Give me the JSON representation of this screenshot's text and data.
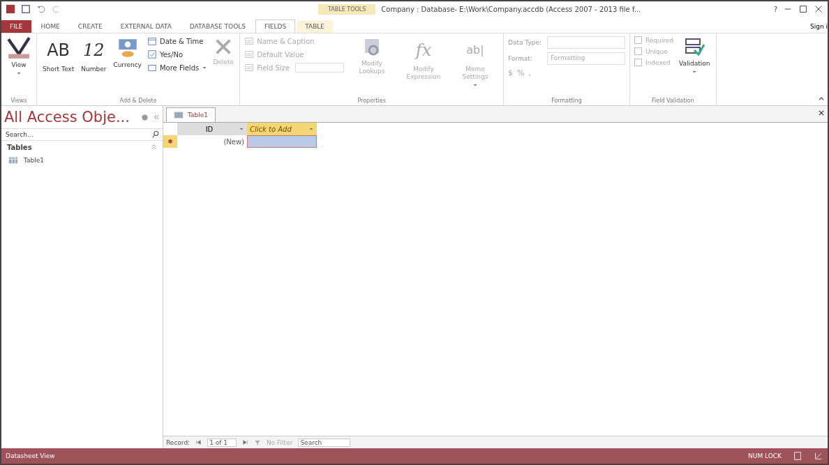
{
  "window": {
    "title": "Company : Database- E:\\Work\\Company.accdb (Access 2007 - 2013 file f...",
    "help": "?",
    "contextual_label": "TABLE TOOLS"
  },
  "tabs": [
    {
      "label": "FILE",
      "kind": "file",
      "selected": false
    },
    {
      "label": "HOME",
      "kind": "normal",
      "selected": false
    },
    {
      "label": "CREATE",
      "kind": "normal",
      "selected": false
    },
    {
      "label": "EXTERNAL DATA",
      "kind": "normal",
      "selected": false
    },
    {
      "label": "DATABASE TOOLS",
      "kind": "normal",
      "selected": false
    },
    {
      "label": "FIELDS",
      "kind": "contextual",
      "selected": true
    },
    {
      "label": "TABLE",
      "kind": "contextual",
      "selected": false
    }
  ],
  "sign_in": "Sign i",
  "ribbon": [
    {
      "label": "Views",
      "items": [
        {
          "kind": "large",
          "label": "View",
          "dropdown": true,
          "disabled": false
        }
      ]
    },
    {
      "label": "Add & Delete",
      "items": [
        {
          "kind": "large",
          "glyph": "AB",
          "label": "Short Text",
          "dropdown": false,
          "disabled": false
        },
        {
          "kind": "large",
          "glyph": "12",
          "label": "Number",
          "dropdown": false,
          "disabled": false
        },
        {
          "kind": "large",
          "label": "Currency",
          "dropdown": false,
          "disabled": false
        },
        {
          "kind": "stack",
          "items": [
            {
              "label": "Date & Time",
              "dropdown": false,
              "disabled": false
            },
            {
              "label": "Yes/No",
              "dropdown": false,
              "disabled": false
            },
            {
              "label": "More Fields",
              "dropdown": true,
              "disabled": false
            }
          ]
        },
        {
          "kind": "large",
          "label": "Delete",
          "dropdown": false,
          "disabled": true
        }
      ]
    },
    {
      "label": "Properties",
      "items": [
        {
          "kind": "stack",
          "items": [
            {
              "label": "Name & Caption",
              "dropdown": false,
              "disabled": true
            },
            {
              "label": "Default Value",
              "dropdown": false,
              "disabled": true
            },
            {
              "label": "Field Size",
              "field": true,
              "dropdown": false,
              "disabled": true
            }
          ]
        },
        {
          "kind": "large",
          "label": "Modify Lookups",
          "dropdown": false,
          "disabled": true
        },
        {
          "kind": "large",
          "glyph": "fx",
          "label": "Modify Expression",
          "dropdown": false,
          "disabled": true
        },
        {
          "kind": "large",
          "glyph": "ab|",
          "label": "Memo Settings",
          "dropdown": true,
          "disabled": true
        }
      ]
    },
    {
      "label": "Formatting",
      "items": [
        {
          "kind": "format",
          "rows": [
            {
              "label": "Data Type:",
              "value": ""
            },
            {
              "label": "Format:",
              "value": "Formatting"
            }
          ],
          "symbols": [
            "$",
            "%",
            ","
          ],
          "disabled": true
        }
      ]
    },
    {
      "label": "Field Validation",
      "items": [
        {
          "kind": "checks",
          "items": [
            {
              "label": "Required",
              "checked": false,
              "disabled": true
            },
            {
              "label": "Unique",
              "checked": false,
              "disabled": true
            },
            {
              "label": "Indexed",
              "checked": false,
              "disabled": true
            }
          ]
        },
        {
          "kind": "large",
          "label": "Validation",
          "dropdown": true,
          "disabled": false
        }
      ]
    }
  ],
  "nav_pane": {
    "title": "All Access Obje...",
    "search_placeholder": "Search...",
    "sections": [
      {
        "label": "Tables",
        "expanded": true,
        "items": [
          "Table1"
        ]
      }
    ]
  },
  "document": {
    "tab": "Table1",
    "columns": [
      {
        "label": "ID",
        "kind": "field"
      },
      {
        "label": "Click to Add",
        "kind": "add"
      }
    ],
    "rows": [
      {
        "marker": "✱",
        "cells": [
          "(New)",
          ""
        ],
        "new": true
      }
    ],
    "record_nav": {
      "label": "Record:",
      "position": "1 of 1",
      "filter": "No Filter",
      "search": "Search"
    }
  },
  "status_bar": {
    "left": "Datasheet View",
    "indicators": [
      "NUM LOCK"
    ]
  }
}
